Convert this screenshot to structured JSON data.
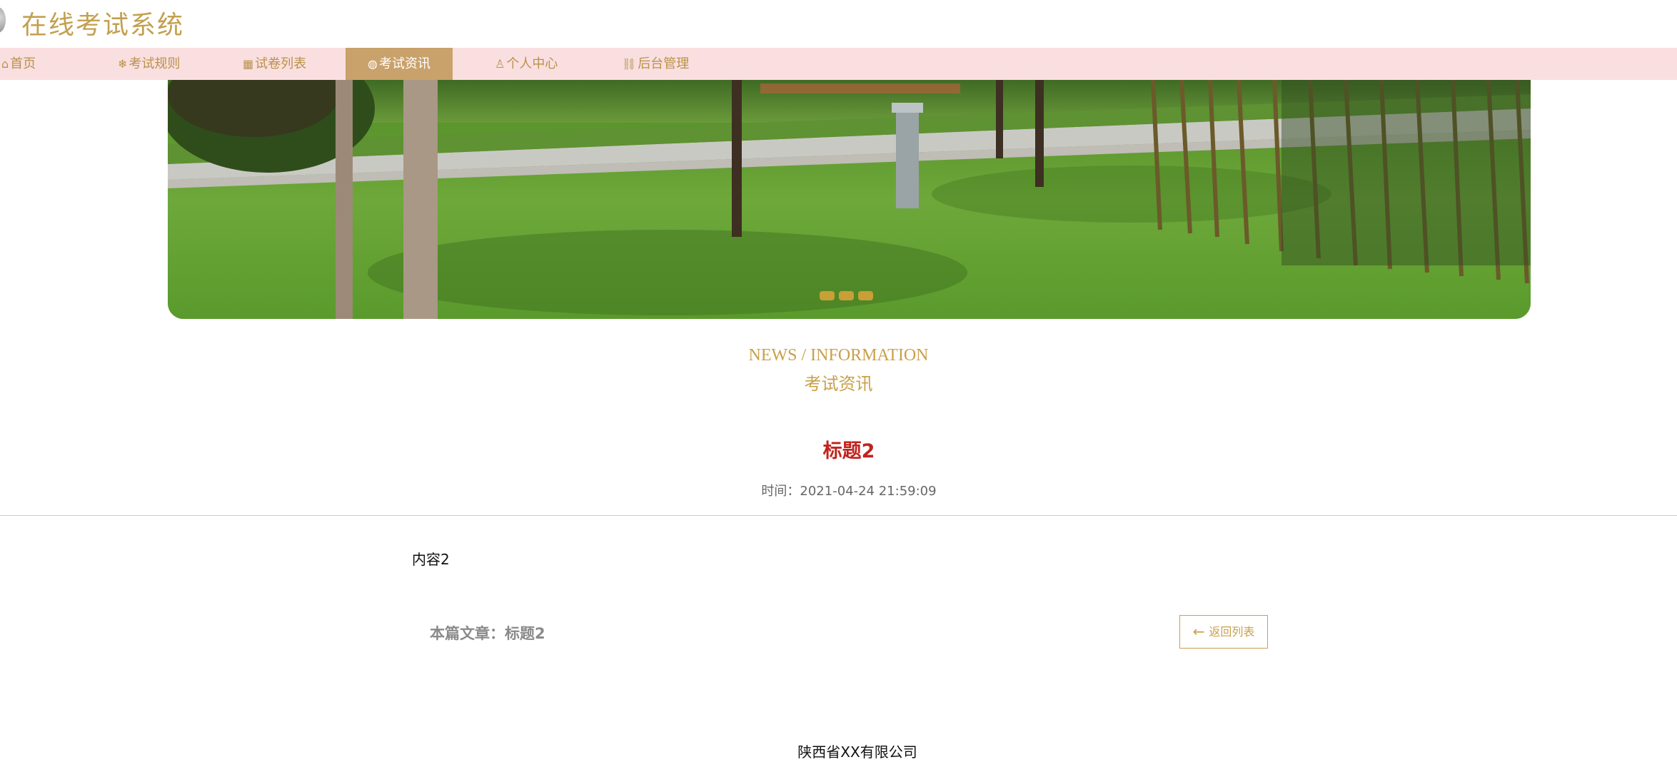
{
  "header": {
    "title": "在线考试系统"
  },
  "nav": {
    "items": [
      {
        "label": "首页",
        "icon": "home-icon",
        "glyph": "⌂"
      },
      {
        "label": "考试规则",
        "icon": "snowflake-icon",
        "glyph": "❄"
      },
      {
        "label": "试卷列表",
        "icon": "grid-icon",
        "glyph": "▦"
      },
      {
        "label": "考试资讯",
        "icon": "globe-icon",
        "glyph": "◍"
      },
      {
        "label": "个人中心",
        "icon": "user-icon",
        "glyph": "♙"
      },
      {
        "label": "后台管理",
        "icon": "link-icon",
        "glyph": "⛓"
      }
    ],
    "active_index": 3
  },
  "banner": {
    "slides": 3,
    "current_slide": 1
  },
  "section": {
    "title_en": "NEWS / INFORMATION",
    "title_cn": "考试资讯"
  },
  "article": {
    "title": "标题2",
    "time": "时间：2021-04-24 21:59:09",
    "content": "内容2",
    "current_label": "本篇文章：标题2",
    "back_label": "返回列表"
  },
  "footer": {
    "company": "陕西省XX有限公司"
  },
  "colors": {
    "accent": "#c3a04f",
    "nav_bg": "#fadfe0",
    "nav_active_bg": "#c9a16a",
    "article_title": "#c0231e"
  }
}
